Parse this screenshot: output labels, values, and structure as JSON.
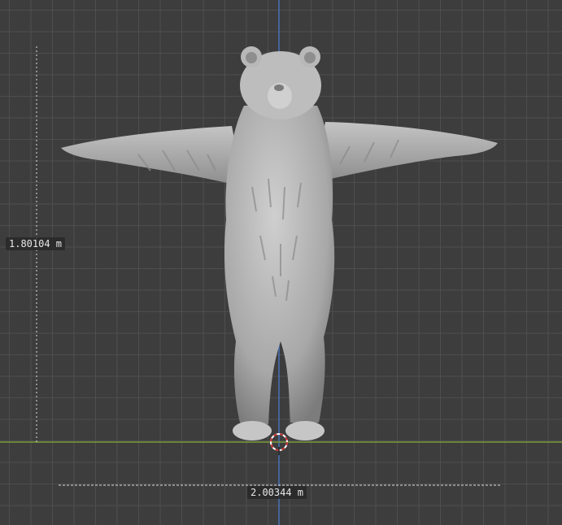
{
  "viewport": {
    "height_measurement": "1.80104 m",
    "width_measurement": "2.00344 m",
    "colors": {
      "background": "#3d3d3d",
      "x_axis": "#7a9a3a",
      "z_axis": "#4a72b8",
      "model": "#b4b4b4",
      "cursor": "#c83030"
    }
  }
}
